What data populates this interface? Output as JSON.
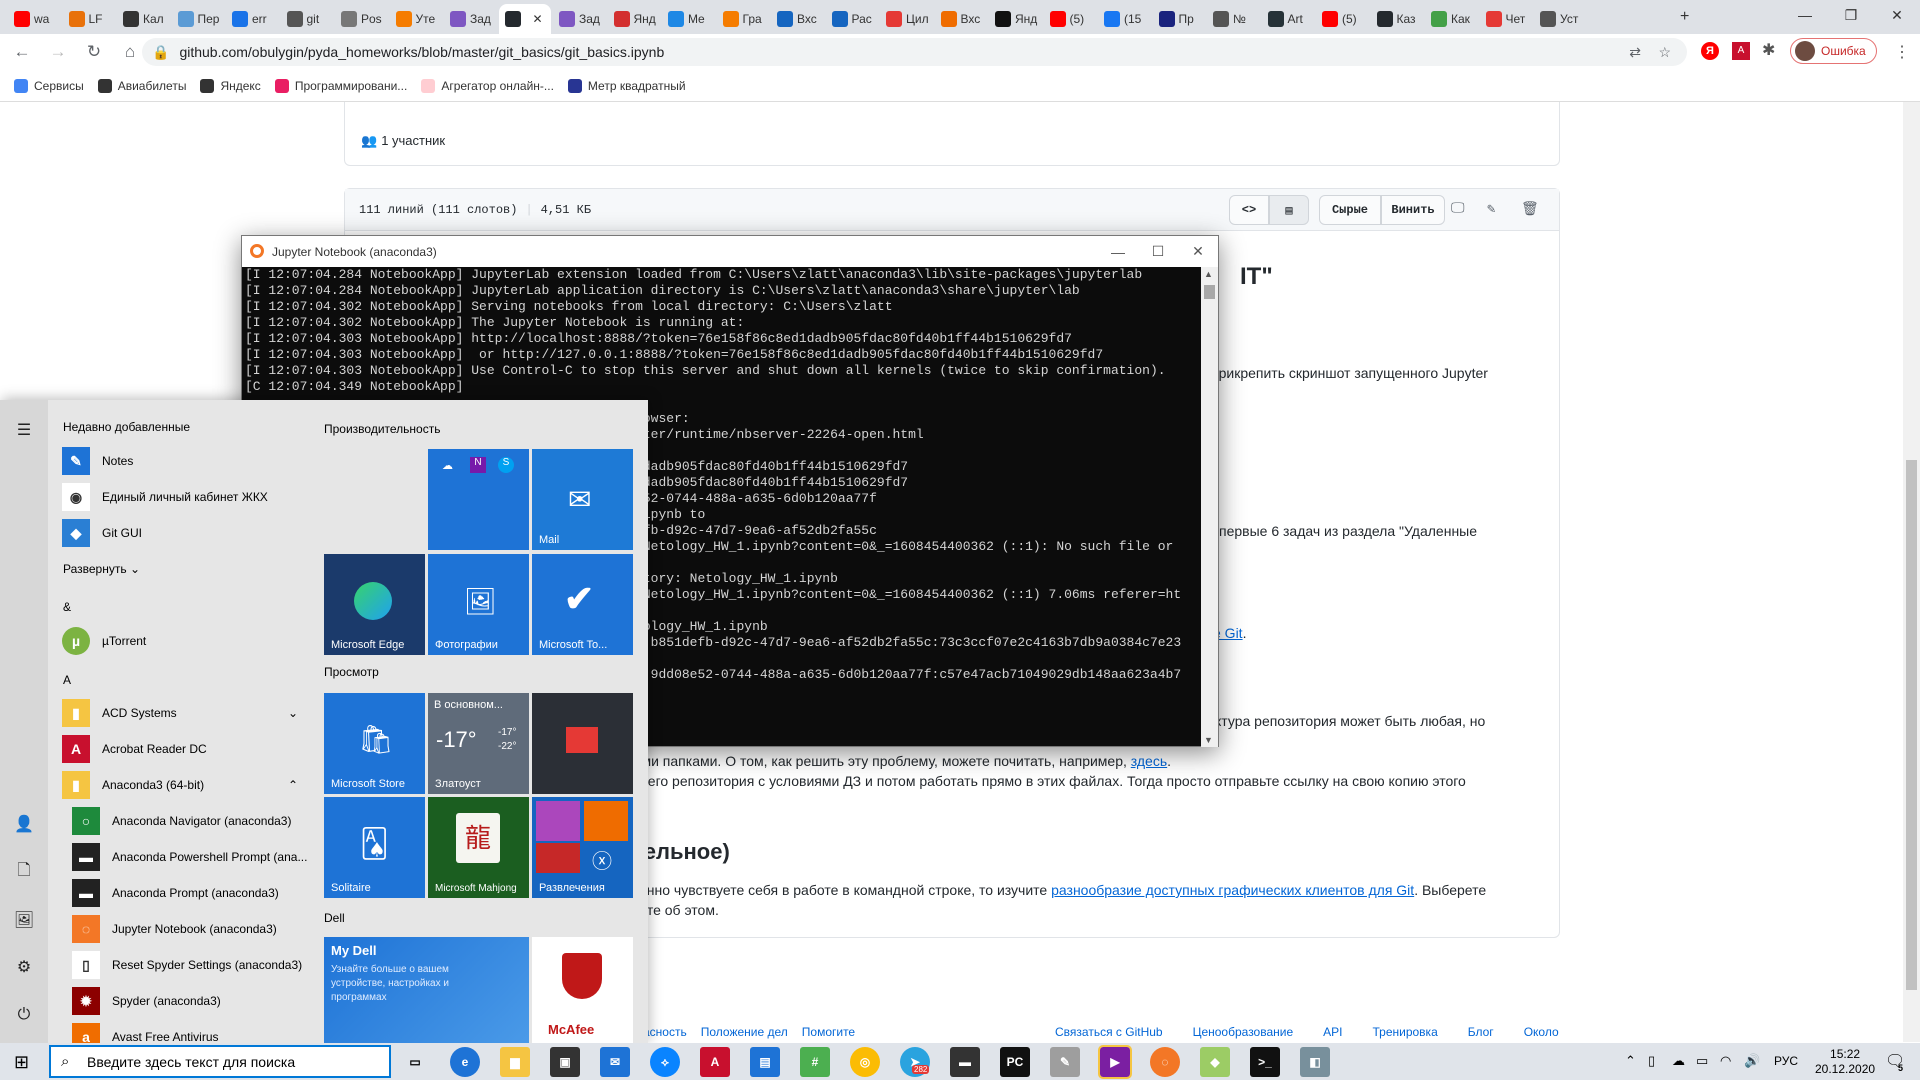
{
  "browser": {
    "tabs": [
      {
        "label": "wa",
        "color": "#ff0000"
      },
      {
        "label": "LF",
        "color": "#e8710a"
      },
      {
        "label": "Кал",
        "color": "#333333"
      },
      {
        "label": "Пер",
        "color": "#5b9bd5"
      },
      {
        "label": "err",
        "color": "#1a73e8"
      },
      {
        "label": "git",
        "color": "#555555"
      },
      {
        "label": "Pos",
        "color": "#777777"
      },
      {
        "label": "Уте",
        "color": "#f57c00"
      },
      {
        "label": "Зад",
        "color": "#7e57c2"
      },
      {
        "label": "",
        "color": "#24292e"
      },
      {
        "label": "Зад",
        "color": "#7e57c2"
      },
      {
        "label": "Янд",
        "color": "#d32f2f"
      },
      {
        "label": "Me",
        "color": "#1e88e5"
      },
      {
        "label": "Гра",
        "color": "#f57c00"
      },
      {
        "label": "Вхс",
        "color": "#1565c0"
      },
      {
        "label": "Рас",
        "color": "#1565c0"
      },
      {
        "label": "Цил",
        "color": "#e53935"
      },
      {
        "label": "Вхс",
        "color": "#ef6c00"
      },
      {
        "label": "Янд",
        "color": "#111111"
      },
      {
        "label": "(5)",
        "color": "#ff0000"
      },
      {
        "label": "(15",
        "color": "#1877f2"
      },
      {
        "label": "Пр",
        "color": "#1a237e"
      },
      {
        "label": "№",
        "color": "#555555"
      },
      {
        "label": "Art",
        "color": "#263238"
      },
      {
        "label": "(5)",
        "color": "#ff0000"
      },
      {
        "label": "Каз",
        "color": "#24292e"
      },
      {
        "label": "Как",
        "color": "#43a047"
      },
      {
        "label": "Чет",
        "color": "#e53935"
      },
      {
        "label": "Уст",
        "color": "#555555"
      }
    ],
    "new_tab": "+",
    "url": "github.com/obulygin/pyda_homeworks/blob/master/git_basics/git_basics.ipynb",
    "profile_error": "Ошибка",
    "bookmarks": [
      {
        "label": "Сервисы",
        "color": "#4285f4"
      },
      {
        "label": "Авиабилеты",
        "color": "#333333"
      },
      {
        "label": "Яндекс",
        "color": "#333333"
      },
      {
        "label": "Программировани...",
        "color": "#e91e63"
      },
      {
        "label": "Агрегатор онлайн-...",
        "color": "#ffcdd2"
      },
      {
        "label": "Метр квадратный",
        "color": "#283593"
      }
    ]
  },
  "github": {
    "contributors": "1 участник",
    "file_info": "111 линий (111 слотов)",
    "file_size": "4,51 КБ",
    "raw_button": "Сырые",
    "blame_button": "Винить",
    "heading_fragment": "IT\"",
    "text_lines": [
      "прикрепить скриншот запущенного Jupyter",
      "первые 6 задач из раздела \"Удаленные",
      "ктура репозитория может быть любая, но",
      "тыми папками. О том, как решить эту проблему, можете почитать, например,",
      "рего репозитория с условиями ДЗ и потом работать прямо в этих файлах. Тогда просто отправьте ссылку на свою копию этого",
      "енно чувствуете себя в работе в командной строке, то изучите",
      "ите об этом."
    ],
    "links": {
      "git_link": "e Git",
      "here_link": "здесь",
      "gui_clients": "разнообразие доступных графических клиентов для Git",
      "after_gui": ". Выберете"
    },
    "optional_heading": "тельное)",
    "footer_left": [
      "ласность",
      "Положение дел",
      "Помогите"
    ],
    "footer_right": [
      "Связаться с GitHub",
      "Ценообразование",
      "API",
      "Тренировка",
      "Блог",
      "Около"
    ]
  },
  "jupyter": {
    "title": "Jupyter Notebook (anaconda3)",
    "lines": [
      "[I 12:07:04.284 NotebookApp] JupyterLab extension loaded from C:\\Users\\zlatt\\anaconda3\\lib\\site-packages\\jupyterlab",
      "[I 12:07:04.284 NotebookApp] JupyterLab application directory is C:\\Users\\zlatt\\anaconda3\\share\\jupyter\\lab",
      "[I 12:07:04.302 NotebookApp] Serving notebooks from local directory: C:\\Users\\zlatt",
      "[I 12:07:04.302 NotebookApp] The Jupyter Notebook is running at:",
      "[I 12:07:04.303 NotebookApp] http://localhost:8888/?token=76e158f86c8ed1dadb905fdac80fd40b1ff44b1510629fd7",
      "[I 12:07:04.303 NotebookApp]  or http://127.0.0.1:8888/?token=76e158f86c8ed1dadb905fdac80fd40b1ff44b1510629fd7",
      "[I 12:07:04.303 NotebookApp] Use Control-C to stop this server and shut down all kernels (twice to skip confirmation).",
      "[C 12:07:04.349 NotebookApp]",
      "",
      "                                                   owser:",
      "                                                   ter/runtime/nbserver-22264-open.html",
      "",
      "                                                   dadb905fdac80fd40b1ff44b1510629fd7",
      "                                                   dadb905fdac80fd40b1ff44b1510629fd7",
      "                                                   52-0744-488a-a635-6d0b120aa77f",
      "                                                   ipynb to",
      "                                                   fb-d92c-47d7-9ea6-af52db2fa55c",
      "                                                   Netology_HW_1.ipynb?content=0&_=1608454400362 (::1): No such file or",
      "",
      "                                                   tory: Netology_HW_1.ipynb",
      "                                                   Netology_HW_1.ipynb?content=0&_=1608454400362 (::1) 7.06ms referer=ht",
      "",
      "                                                   ology_HW_1.ipynb",
      "                                                    b851defb-d92c-47d7-9ea6-af52db2fa55c:73c3ccf07e2c4163b7db9a0384c7e23",
      "",
      "                                                    9dd08e52-0744-488a-a635-6d0b120aa77f:c57e47acb71049029db148aa623a4b7"
    ]
  },
  "start_menu": {
    "recent_header": "Недавно добавленные",
    "recent": [
      {
        "label": "Notes",
        "color": "#1e73d6",
        "glyph": "✎"
      },
      {
        "label": "Единый личный кабинет ЖКХ",
        "color": "#ffffff",
        "glyph": "◉"
      },
      {
        "label": "Git GUI",
        "color": "#2a7fd4",
        "glyph": "◆"
      }
    ],
    "expand": "Развернуть",
    "amp_header": "&",
    "utorrent": "µTorrent",
    "a_header": "A",
    "apps": [
      {
        "label": "ACD Systems",
        "color": "#f5c542",
        "glyph": "▮",
        "chevron": "⌄"
      },
      {
        "label": "Acrobat Reader DC",
        "color": "#c8102e",
        "glyph": "A",
        "chevron": ""
      },
      {
        "label": "Anaconda3 (64-bit)",
        "color": "#f5c542",
        "glyph": "▮",
        "chevron": "⌃"
      }
    ],
    "anaconda_items": [
      {
        "label": "Anaconda Navigator (anaconda3)",
        "color": "#1e8a3c",
        "glyph": "○"
      },
      {
        "label": "Anaconda Powershell Prompt (ana...",
        "color": "#222222",
        "glyph": "▬"
      },
      {
        "label": "Anaconda Prompt (anaconda3)",
        "color": "#222222",
        "glyph": "▬"
      },
      {
        "label": "Jupyter Notebook (anaconda3)",
        "color": "#f37726",
        "glyph": "◌"
      },
      {
        "label": "Reset Spyder Settings (anaconda3)",
        "color": "#ffffff",
        "glyph": "▯"
      },
      {
        "label": "Spyder (anaconda3)",
        "color": "#8c0000",
        "glyph": "✹"
      },
      {
        "label": "Avast Free Antivirus",
        "color": "#f06d00",
        "glyph": "a"
      }
    ],
    "productivity_header": "Производительность",
    "view_header": "Просмотр",
    "dell_header": "Dell",
    "tiles": {
      "mail": "Mail",
      "edge": "Microsoft Edge",
      "photos": "Фотографии",
      "todo": "Microsoft To...",
      "store": "Microsoft Store",
      "weather_cond": "В основном...",
      "weather_temp": "-17°",
      "weather_hi": "-17°",
      "weather_lo": "-22°",
      "weather_city": "Златоуст",
      "solitaire": "Solitaire",
      "mahjong": "Microsoft Mahjong",
      "entertainment": "Развлечения",
      "mydell_title": "My Dell",
      "mydell_text": "Узнайте больше о вашем устройстве, настройках и программах",
      "mcafee": "McAfee"
    }
  },
  "taskbar": {
    "search_placeholder": "Введите здесь текст для поиска",
    "lang": "РУС",
    "time": "15:22",
    "date": "20.12.2020",
    "notif_count": "5",
    "telegram_badge": "282"
  }
}
